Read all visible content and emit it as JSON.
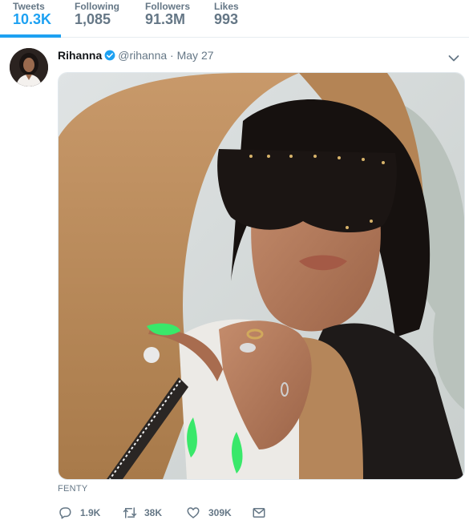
{
  "stats": [
    {
      "label": "Tweets",
      "value": "10.3K"
    },
    {
      "label": "Following",
      "value": "1,085"
    },
    {
      "label": "Followers",
      "value": "91.3M"
    },
    {
      "label": "Likes",
      "value": "993"
    }
  ],
  "tweet": {
    "name": "Rihanna",
    "handle": "@rihanna",
    "separator": "·",
    "time": "May 27",
    "caption": "FENTY",
    "actions": {
      "replies": "1.9K",
      "retweets": "38K",
      "likes": "309K"
    }
  },
  "colors": {
    "accent": "#1da1f2",
    "muted": "#657786",
    "verified": "#1da1f2",
    "nails": "#39e86a",
    "jacket": "#b88a57"
  },
  "icons": [
    "verified-badge-icon",
    "chevron-down-icon",
    "reply-icon",
    "retweet-icon",
    "heart-icon",
    "envelope-icon"
  ]
}
